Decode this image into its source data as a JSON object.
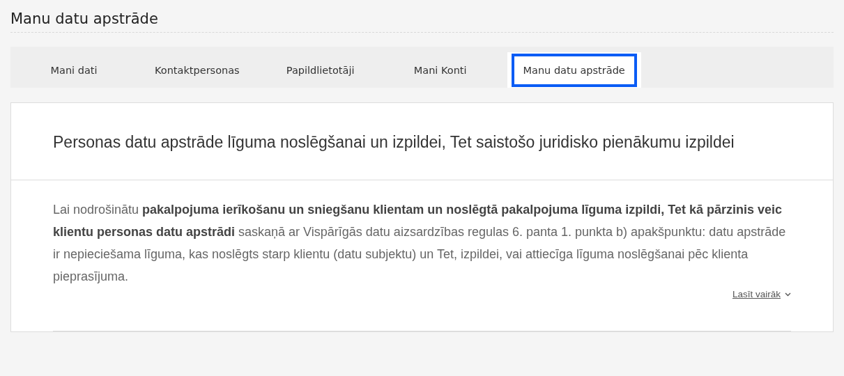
{
  "page_title": "Manu datu apstrāde",
  "tabs": [
    {
      "label": "Mani dati",
      "selected": false
    },
    {
      "label": "Kontaktpersonas",
      "selected": false
    },
    {
      "label": "Papildlietotāji",
      "selected": false
    },
    {
      "label": "Mani Konti",
      "selected": false
    },
    {
      "label": "Manu datu apstrāde",
      "selected": true
    }
  ],
  "section": {
    "heading": "Personas datu apstrāde līguma noslēgšanai un izpildei, Tet saistošo juridisko pienākumu izpildei",
    "paragraph": "Lai nodrošinātu **pakalpojuma ierīkošanu un sniegšanu klientam un noslēgtā pakalpojuma līguma izpildi, Tet kā pārzinis veic klientu personas datu apstrādi** saskaņā ar Vispārīgās datu aizsardzības regulas 6. panta 1. punkta b) apakšpunktu: datu apstrāde ir nepieciešama līguma, kas noslēgts starp klientu (datu subjektu) un Tet, izpildei, vai attiecīga līguma noslēgšanai pēc klienta pieprasījuma.",
    "read_more": "Lasīt vairāk"
  }
}
